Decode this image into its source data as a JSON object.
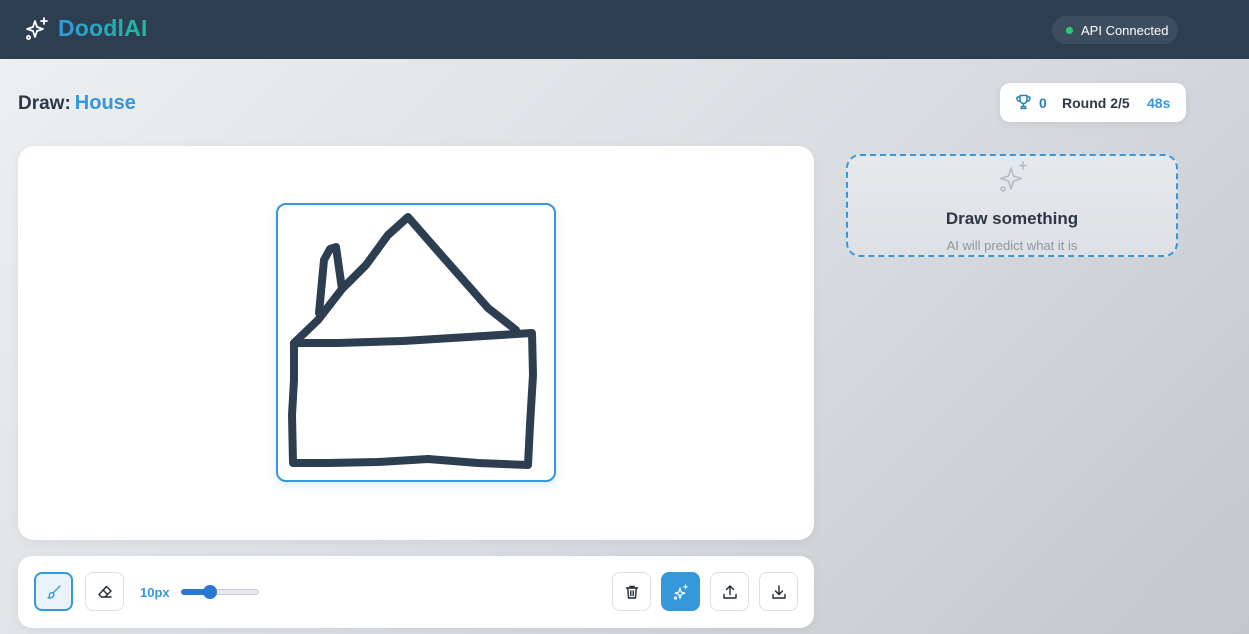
{
  "header": {
    "app_name": "DoodlAI",
    "api_status": "API Connected",
    "api_status_color": "#2ecc71"
  },
  "game": {
    "draw_prefix": "Draw:",
    "target_word": "House",
    "score": "0",
    "round": "Round 2/5",
    "timer": "48s"
  },
  "prediction": {
    "title": "Draw something",
    "subtitle": "AI will predict what it is"
  },
  "toolbar": {
    "brush_size": "10px",
    "brush_size_value": 10,
    "brush_size_fraction": 0.35,
    "tools": [
      "brush",
      "eraser"
    ],
    "actions": [
      "clear",
      "predict",
      "upload",
      "download"
    ]
  },
  "colors": {
    "accent": "#3498db",
    "header_bg": "#2c3e50",
    "stroke": "#2c3e50"
  }
}
